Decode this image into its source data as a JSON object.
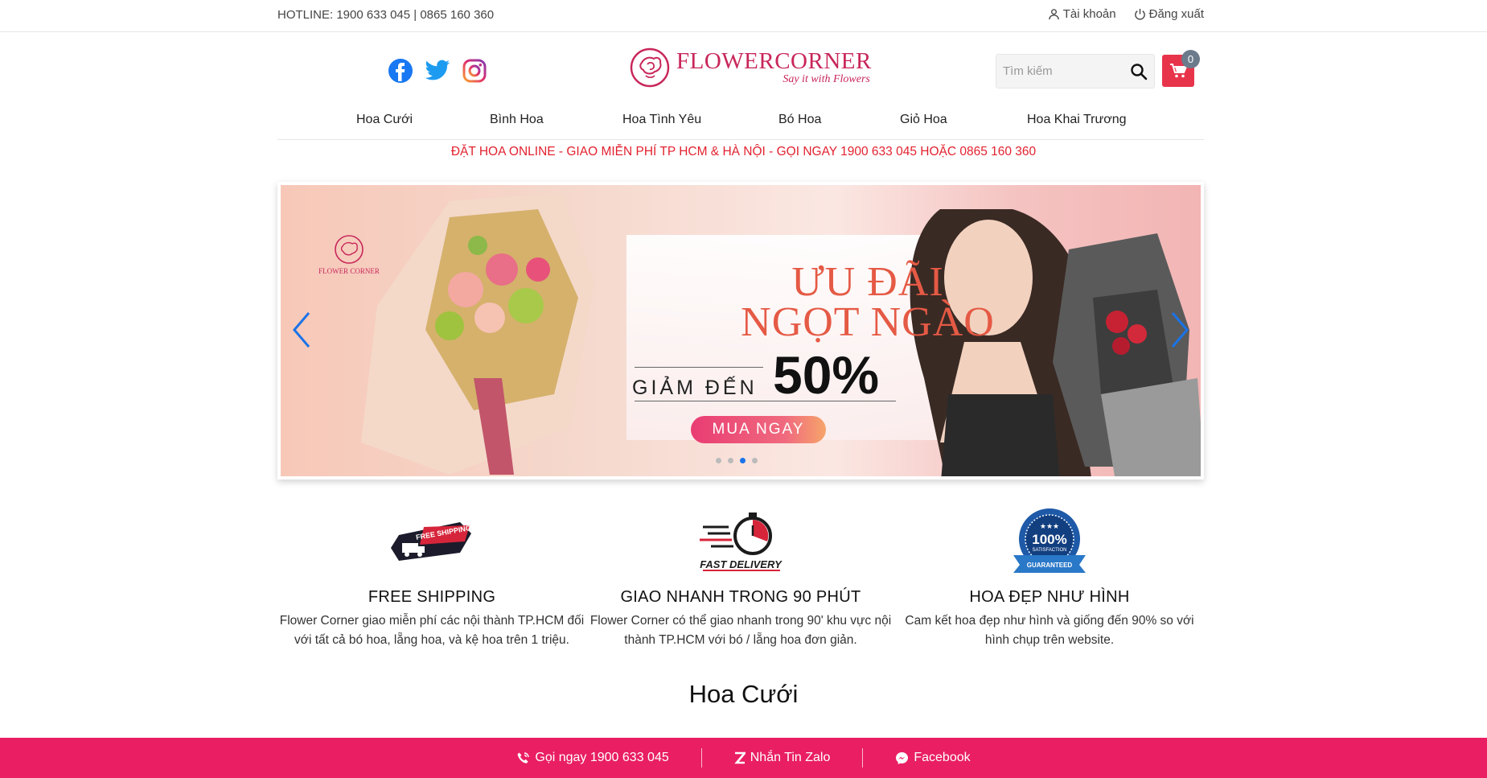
{
  "topbar": {
    "hotline": "HOTLINE: 1900 633 045 | 0865 160 360",
    "account": "Tài khoản",
    "logout": "Đăng xuất"
  },
  "header": {
    "brand": "FLOWERCORNER",
    "tagline": "Say it with Flowers",
    "search_placeholder": "Tìm kiếm",
    "cart_count": "0",
    "social": [
      "facebook-icon",
      "twitter-icon",
      "instagram-icon"
    ]
  },
  "nav": {
    "items": [
      "Hoa Cưới",
      "Bình Hoa",
      "Hoa Tình Yêu",
      "Bó Hoa",
      "Giỏ Hoa",
      "Hoa Khai Trương"
    ]
  },
  "promo": "ĐẶT HOA ONLINE - GIAO MIỄN PHÍ TP HCM & HÀ NỘI - GỌI NGAY 1900 633 045 HOẶC 0865 160 360",
  "banner": {
    "line1": "ƯU ĐÃI",
    "line2": "NGỌT NGÀO",
    "discount_label": "GIẢM ĐẾN",
    "discount_value": "50%",
    "cta": "MUA NGAY",
    "logo_text": "FLOWER CORNER",
    "slides_total": 4,
    "active_slide": 3
  },
  "features": [
    {
      "badge": "FREE SHIPPING",
      "title": "FREE SHIPPING",
      "desc": "Flower Corner giao miễn phí các nội thành TP.HCM đối với tất cả bó hoa, lẵng hoa, và kệ hoa trên 1 triệu."
    },
    {
      "badge": "FAST DELIVERY",
      "title": "GIAO NHANH TRONG 90 PHÚT",
      "desc": "Flower Corner có thể giao nhanh trong 90' khu vực nội thành TP.HCM với bó / lẵng hoa đơn giản."
    },
    {
      "badge_top": "100%",
      "badge_mid": "SATISFACTION",
      "badge_bottom": "GUARANTEED",
      "title": "HOA ĐẸP NHƯ HÌNH",
      "desc": "Cam kết hoa đẹp như hình và giống đến 90% so với hình chụp trên website."
    }
  ],
  "section_title": "Hoa Cưới",
  "bottombar": {
    "call": "Gọi ngay 1900 633 045",
    "zalo": "Nhắn Tin Zalo",
    "facebook": "Facebook"
  },
  "colors": {
    "brand": "#c8275a",
    "promo_red": "#e2222f",
    "bottom_bar": "#e91e63",
    "cart": "#e8344b"
  }
}
